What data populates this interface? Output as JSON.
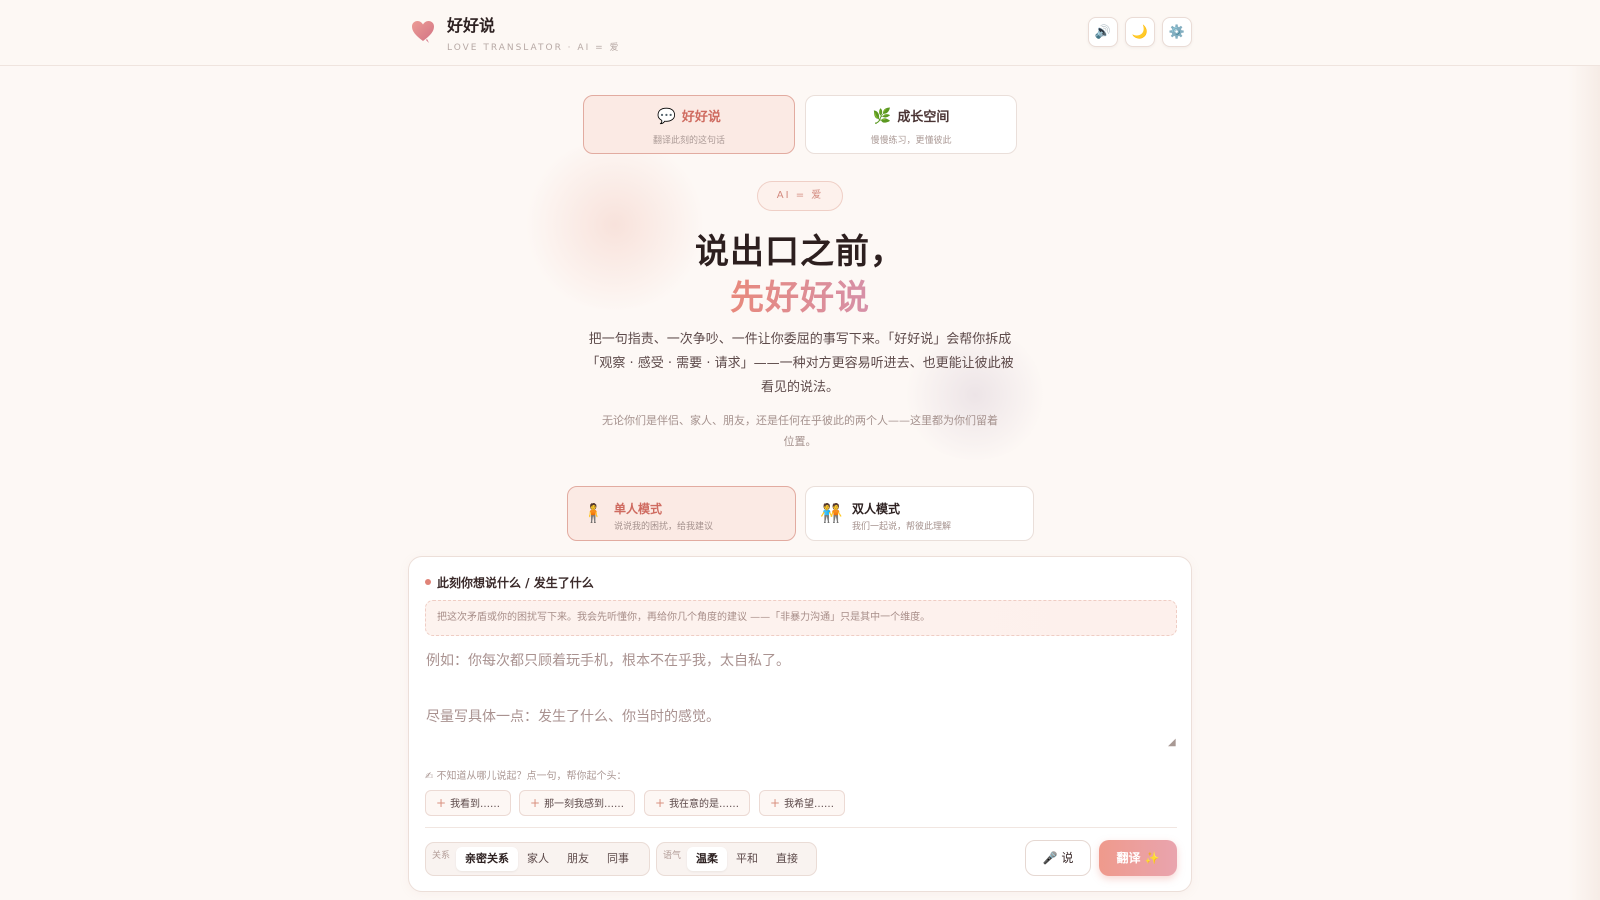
{
  "header": {
    "brand": "好好说",
    "subtitle": "LOVE TRANSLATOR · AI = 爱",
    "buttons": [
      {
        "icon": "speaker-icon",
        "glyph": "🔊"
      },
      {
        "icon": "moon-icon",
        "glyph": "🌙"
      },
      {
        "icon": "gear-icon",
        "glyph": "⚙️"
      }
    ]
  },
  "top_tabs": [
    {
      "icon": "speech-bubble-icon",
      "glyph": "💬",
      "title": "好好说",
      "sub": "翻译此刻的这句话",
      "active": true
    },
    {
      "icon": "leaf-icon",
      "glyph": "🌿",
      "title": "成长空间",
      "sub": "慢慢练习，更懂彼此",
      "active": false
    }
  ],
  "hero": {
    "badge": "AI = 爱",
    "line1": "说出口之前，",
    "line2": "先好好说",
    "desc": "把一句指责、一次争吵、一件让你委屈的事写下来。「好好说」会帮你拆成「观察 · 感受 · 需要 · 请求」——一种对方更容易听进去、也更能让彼此被看见的说法。",
    "desc_sub": "无论你们是伴侣、家人、朋友，还是任何在乎彼此的两个人——这里都为你们留着位置。"
  },
  "modes": [
    {
      "icon": "single-person-icon",
      "glyph": "🧍",
      "title": "单人模式",
      "sub": "说说我的困扰，给我建议",
      "active": true
    },
    {
      "icon": "two-people-icon",
      "glyph": "🧑‍🤝‍🧑",
      "title": "双人模式",
      "sub": "我们一起说，帮彼此理解",
      "active": false
    }
  ],
  "card": {
    "title": "此刻你想说什么 / 发生了什么",
    "hint": "把这次矛盾或你的困扰写下来。我会先听懂你，再给你几个角度的建议 ——「非暴力沟通」只是其中一个维度。",
    "placeholder": "例如：你每次都只顾着玩手机，根本不在乎我，太自私了。\n\n尽量写具体一点：发生了什么、你当时的感觉。",
    "value": "",
    "starter_label": "✍ 不知道从哪儿说起？点一句，帮你起个头：",
    "starters": [
      "我看到……",
      "那一刻我感到……",
      "我在意的是……",
      "我希望……"
    ],
    "relation": {
      "label": "关系",
      "options": [
        "亲密关系",
        "家人",
        "朋友",
        "同事"
      ],
      "selected": "亲密关系"
    },
    "tone": {
      "label": "语气",
      "options": [
        "温柔",
        "平和",
        "直接"
      ],
      "selected": "温柔"
    },
    "speak_label": "🎤 说",
    "translate_label": "翻译 ✨"
  },
  "colors": {
    "accent": "#cf6b60",
    "background": "#fdf8f5",
    "button_gradient_start": "#ef9a8c",
    "button_gradient_end": "#e9a4ae"
  }
}
